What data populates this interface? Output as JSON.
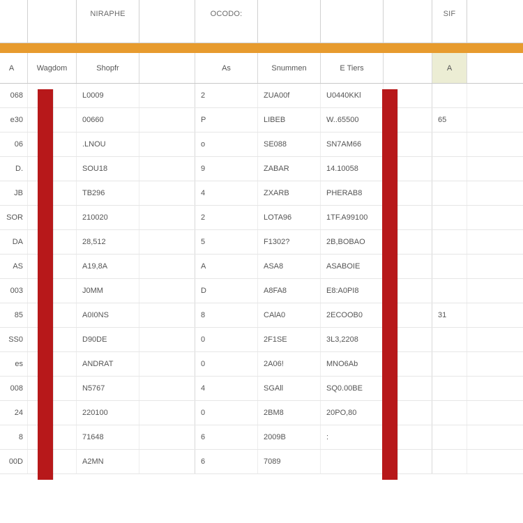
{
  "colors": {
    "accent_orange": "#e79b2e",
    "accent_red": "#b7181a",
    "accent_green_cell": "#ecedd4"
  },
  "top_headers": {
    "c0": "",
    "c1": "",
    "c2": "NIRAPHE",
    "c3": "",
    "c4": "OCODO:",
    "c5": "",
    "c6": "",
    "c7": "",
    "c8": "SIF"
  },
  "sub_headers": {
    "c0": "A",
    "c1": "Wagdom",
    "c2": "Shopfr",
    "c3": "",
    "c4": "As",
    "c5": "Snummen",
    "c6": "E Tiers",
    "c7": "",
    "c8": "A"
  },
  "rows": [
    {
      "c0": "068",
      "c1": "",
      "c2": "L0009",
      "c3": "",
      "c4": "2",
      "c5": "ZUA00f",
      "c6": "U0440KKl",
      "c7": "",
      "c8": ""
    },
    {
      "c0": "e30",
      "c1": "",
      "c2": "00660",
      "c3": "",
      "c4": "P",
      "c5": "LIBEB",
      "c6": "W..65500",
      "c7": "",
      "c8": "65"
    },
    {
      "c0": "06",
      "c1": "",
      "c2": ".LNOU",
      "c3": "",
      "c4": "o",
      "c5": "SE088",
      "c6": "SN7AM66",
      "c7": "",
      "c8": ""
    },
    {
      "c0": "D.",
      "c1": "",
      "c2": "SOU18",
      "c3": "",
      "c4": "9",
      "c5": "ZABAR",
      "c6": "14.10058",
      "c7": "",
      "c8": ""
    },
    {
      "c0": "JB",
      "c1": "",
      "c2": "TB296",
      "c3": "",
      "c4": "4",
      "c5": "ZXARB",
      "c6": "PHERAB8",
      "c7": "",
      "c8": ""
    },
    {
      "c0": "SOR",
      "c1": "",
      "c2": "210020",
      "c3": "",
      "c4": "2",
      "c5": "LOTA96",
      "c6": "1TF.A99100",
      "c7": "",
      "c8": ""
    },
    {
      "c0": "DA",
      "c1": "",
      "c2": "28,512",
      "c3": "",
      "c4": "5",
      "c5": "F1302?",
      "c6": "2B,BOBAO",
      "c7": "",
      "c8": ""
    },
    {
      "c0": "AS",
      "c1": "",
      "c2": "A19,8A",
      "c3": "",
      "c4": "A",
      "c5": "ASA8",
      "c6": "ASABOIE",
      "c7": "",
      "c8": ""
    },
    {
      "c0": "003",
      "c1": "",
      "c2": "J0MM",
      "c3": "",
      "c4": "D",
      "c5": "A8FA8",
      "c6": "E8:A0PI8",
      "c7": "",
      "c8": ""
    },
    {
      "c0": "85",
      "c1": "",
      "c2": "A0I0NS",
      "c3": "",
      "c4": "8",
      "c5": "CAlA0",
      "c6": "2ECOOB0",
      "c7": "",
      "c8": "31"
    },
    {
      "c0": "SS0",
      "c1": "",
      "c2": "D90DE",
      "c3": "",
      "c4": "0",
      "c5": "2F1SE",
      "c6": "3L3,2208",
      "c7": "",
      "c8": ""
    },
    {
      "c0": "es",
      "c1": "",
      "c2": "ANDRAT",
      "c3": "",
      "c4": "0",
      "c5": "2A06!",
      "c6": "MNO6Ab",
      "c7": "",
      "c8": ""
    },
    {
      "c0": "008",
      "c1": "",
      "c2": "N5767",
      "c3": "",
      "c4": "4",
      "c5": "SGAll",
      "c6": "SQ0.00BE",
      "c7": "",
      "c8": ""
    },
    {
      "c0": "24",
      "c1": "",
      "c2": "220100",
      "c3": "",
      "c4": "0",
      "c5": "2BM8",
      "c6": "20PO,80",
      "c7": "",
      "c8": ""
    },
    {
      "c0": "8",
      "c1": "",
      "c2": "71648",
      "c3": "",
      "c4": "6",
      "c5": "2009B",
      "c6": ":",
      "c7": "",
      "c8": ""
    },
    {
      "c0": "00D",
      "c1": "",
      "c2": "A2MN",
      "c3": "",
      "c4": "6",
      "c5": "7089",
      "c6": "",
      "c7": "",
      "c8": ""
    }
  ]
}
